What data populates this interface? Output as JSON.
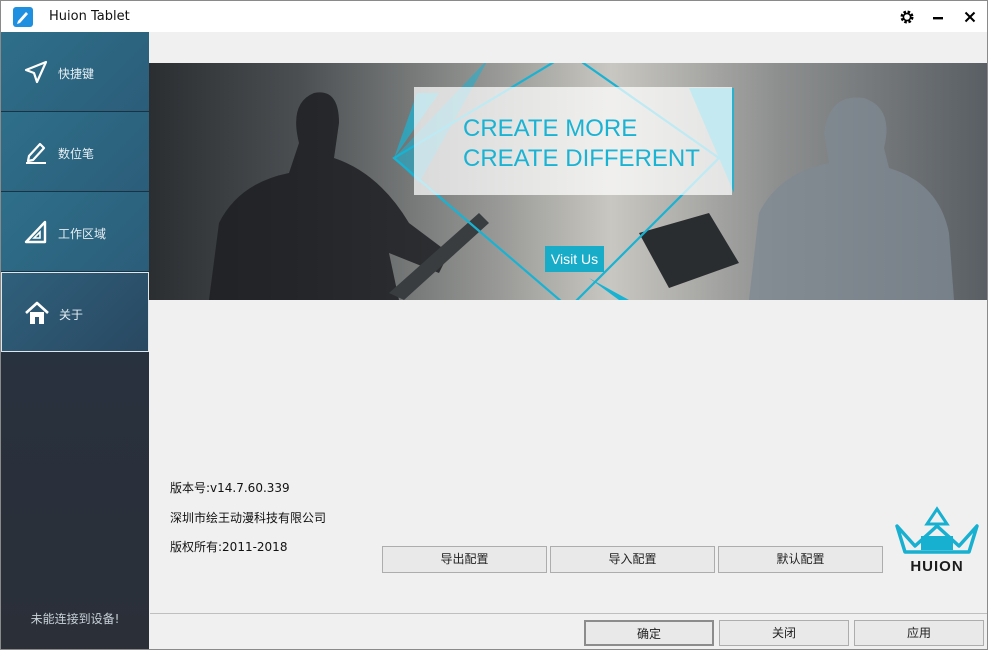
{
  "window": {
    "title": "Huion Tablet"
  },
  "sidebar": {
    "items": [
      {
        "label": "快捷键",
        "icon": "send-icon"
      },
      {
        "label": "数位笔",
        "icon": "pen-icon"
      },
      {
        "label": "工作区域",
        "icon": "work-area-icon"
      },
      {
        "label": "关于",
        "icon": "home-icon",
        "active": true
      }
    ],
    "status": "未能连接到设备!"
  },
  "banner": {
    "line1": "CREATE MORE",
    "line2": "CREATE DIFFERENT",
    "visit": "Visit Us"
  },
  "info": {
    "version": "版本号:v14.7.60.339",
    "company": "深圳市绘王动漫科技有限公司",
    "copyright": "版权所有:2011-2018"
  },
  "config": {
    "export": "导出配置",
    "import": "导入配置",
    "default": "默认配置"
  },
  "logo": {
    "text": "HUION"
  },
  "footer": {
    "ok": "确定",
    "close": "关闭",
    "apply": "应用"
  },
  "colors": {
    "accent": "#18acc9",
    "sidebar": "#2b5d79"
  }
}
